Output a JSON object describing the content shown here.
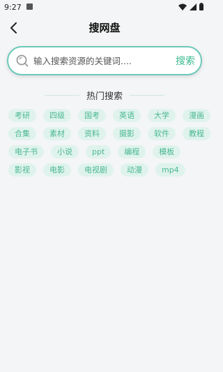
{
  "status_bar": {
    "time": "9:27",
    "icons": [
      "notification-icon",
      "wifi-icon",
      "cell-signal-icon",
      "battery-icon"
    ]
  },
  "header": {
    "title": "搜网盘",
    "back_icon": "chevron-left-icon"
  },
  "search": {
    "placeholder": "输入搜索资源的关键词....",
    "button_label": "搜索",
    "icon": "search-icon",
    "accent_color": "#6cc9b8",
    "button_color": "#3dbb8f"
  },
  "hot_search": {
    "title": "热门搜索",
    "tag_bg": "#dff3ec",
    "tag_color": "#4bb794",
    "rows": [
      [
        "考研",
        "四级",
        "国考",
        "英语",
        "大学",
        "漫画"
      ],
      [
        "合集",
        "素材",
        "资料",
        "摄影",
        "软件",
        "教程"
      ],
      [
        "电子书",
        "小说",
        "ppt",
        "编程",
        "模板"
      ],
      [
        "影视",
        "电影",
        "电视剧",
        "动漫",
        "mp4"
      ]
    ]
  }
}
